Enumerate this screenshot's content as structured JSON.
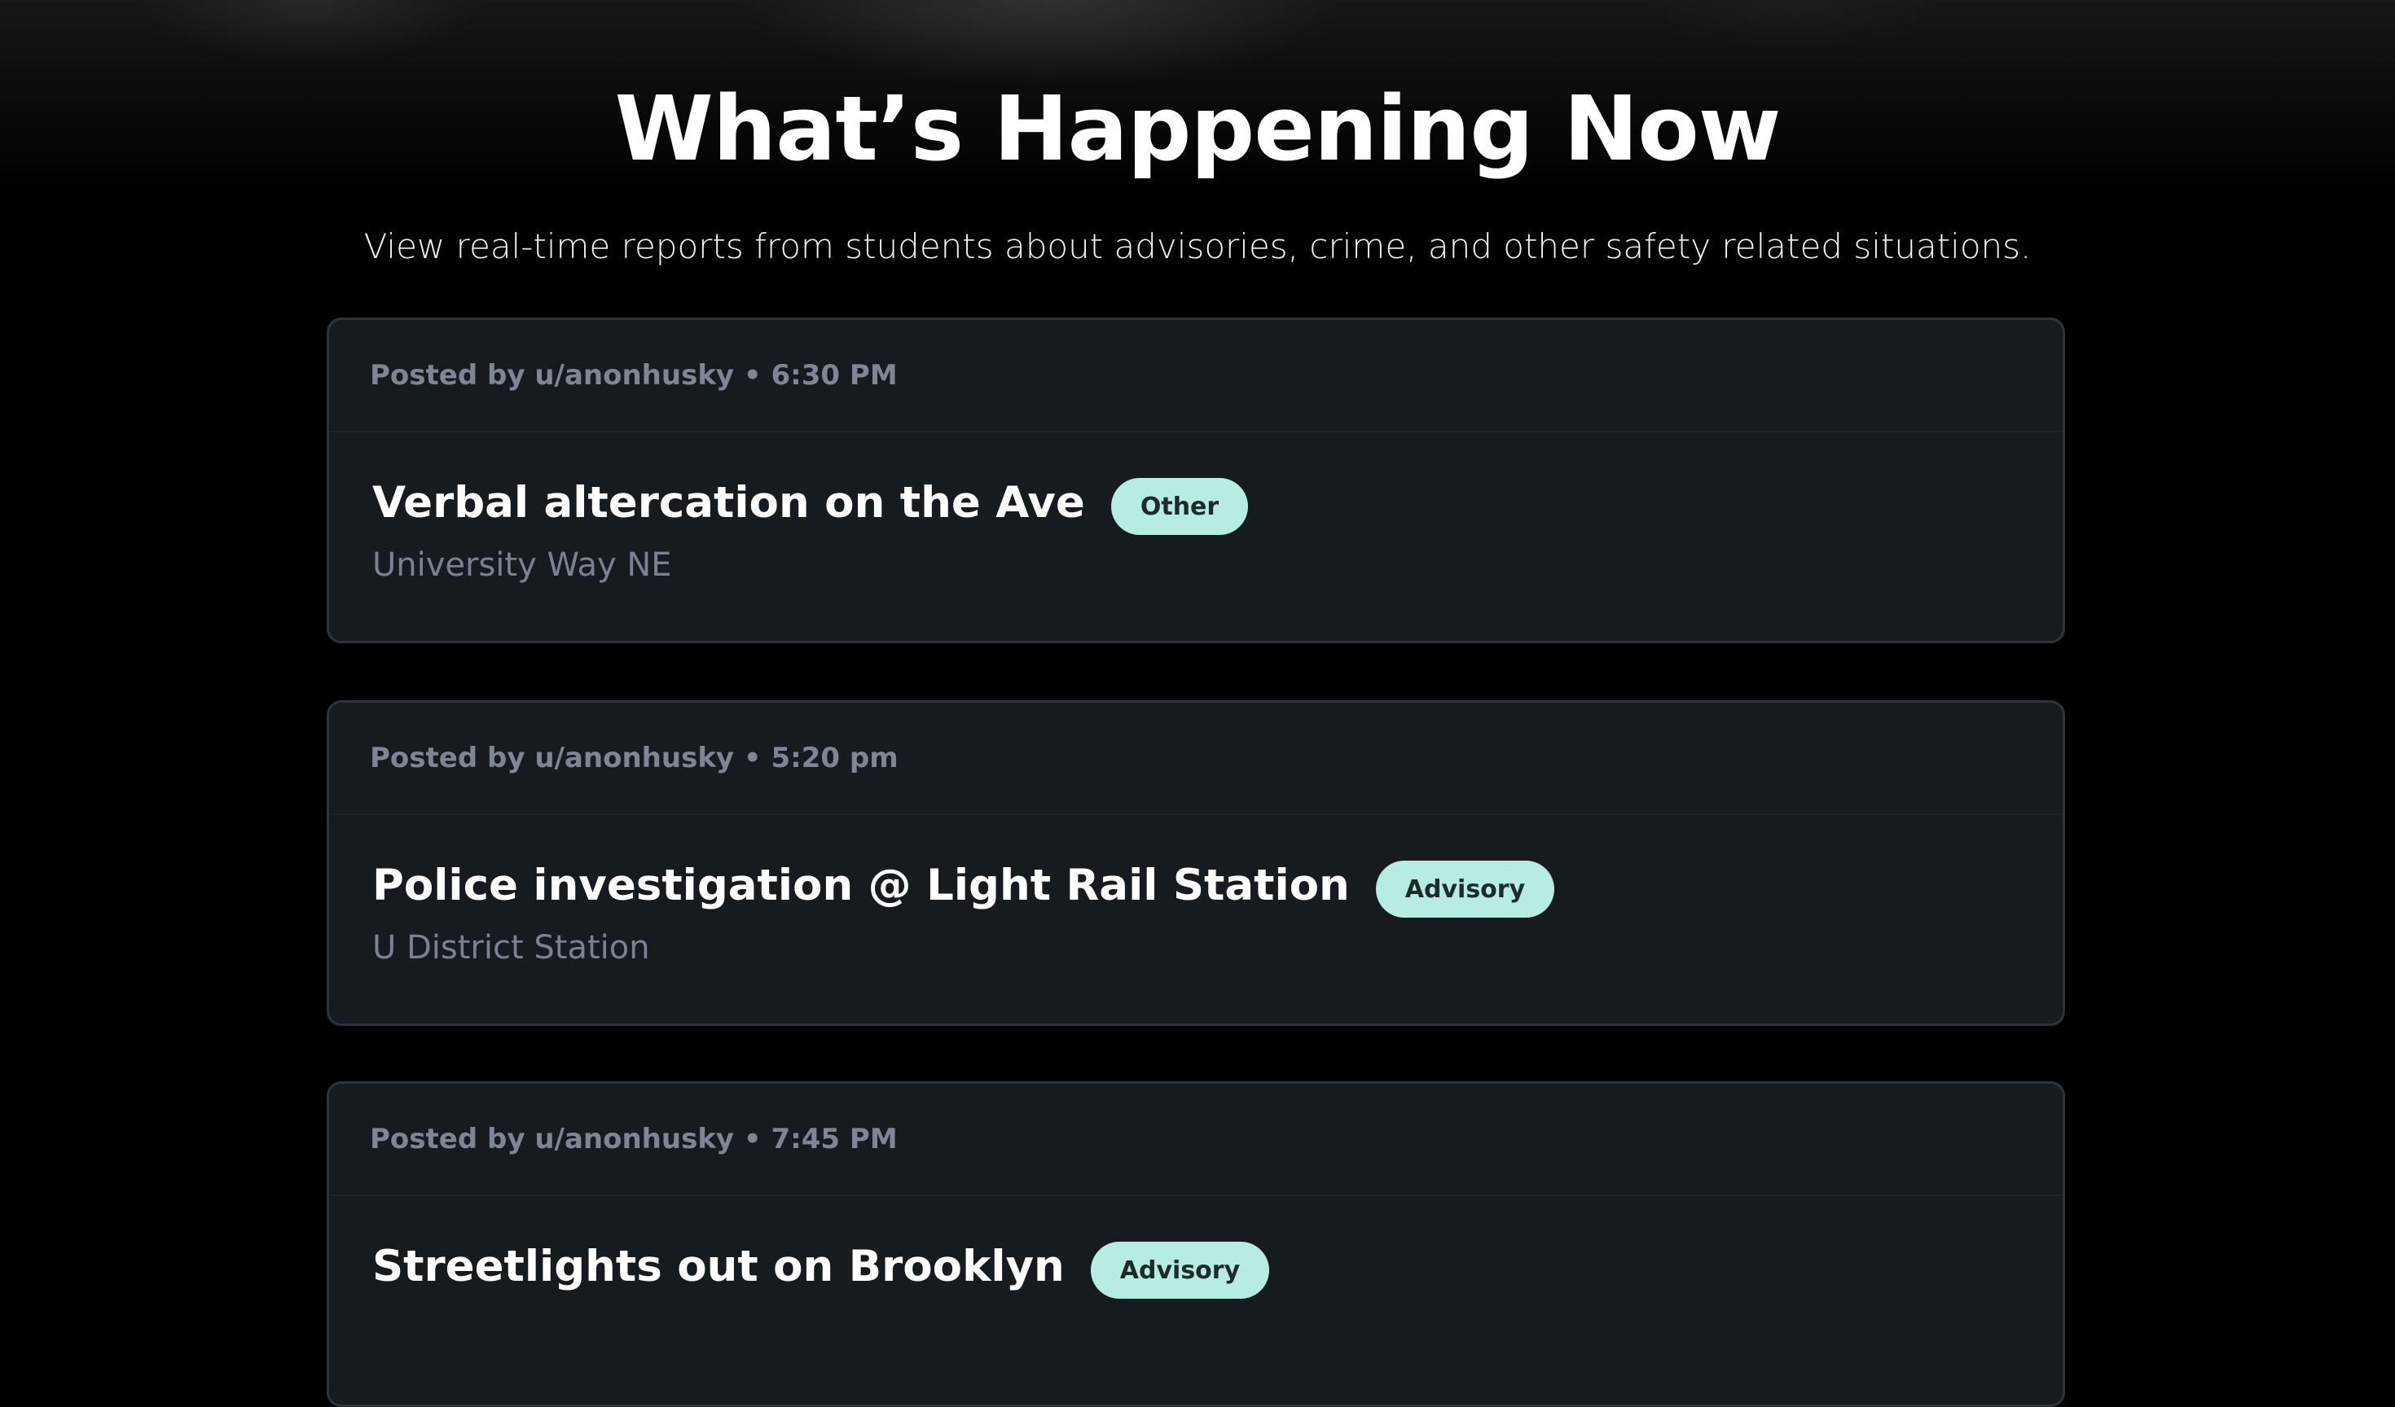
{
  "page": {
    "title": "What’s Happening Now",
    "subtitle": "View real-time reports from students about advisories, crime, and other safety related situations."
  },
  "colors": {
    "background": "#000000",
    "card_background": "#161b20",
    "card_border": "#2e343a",
    "badge_background": "#b6ece2",
    "meta_text": "#7f8693"
  },
  "reports": [
    {
      "meta": "Posted by u/anonhusky • 6:30 PM",
      "title": "Verbal altercation on the Ave",
      "category": "Other",
      "location": "University Way NE"
    },
    {
      "meta": "Posted by u/anonhusky • 5:20 pm",
      "title": "Police investigation @ Light Rail Station",
      "category": "Advisory",
      "location": "U District Station"
    },
    {
      "meta": "Posted by u/anonhusky • 7:45 PM",
      "title": "Streetlights out on Brooklyn",
      "category": "Advisory",
      "location": ""
    }
  ]
}
